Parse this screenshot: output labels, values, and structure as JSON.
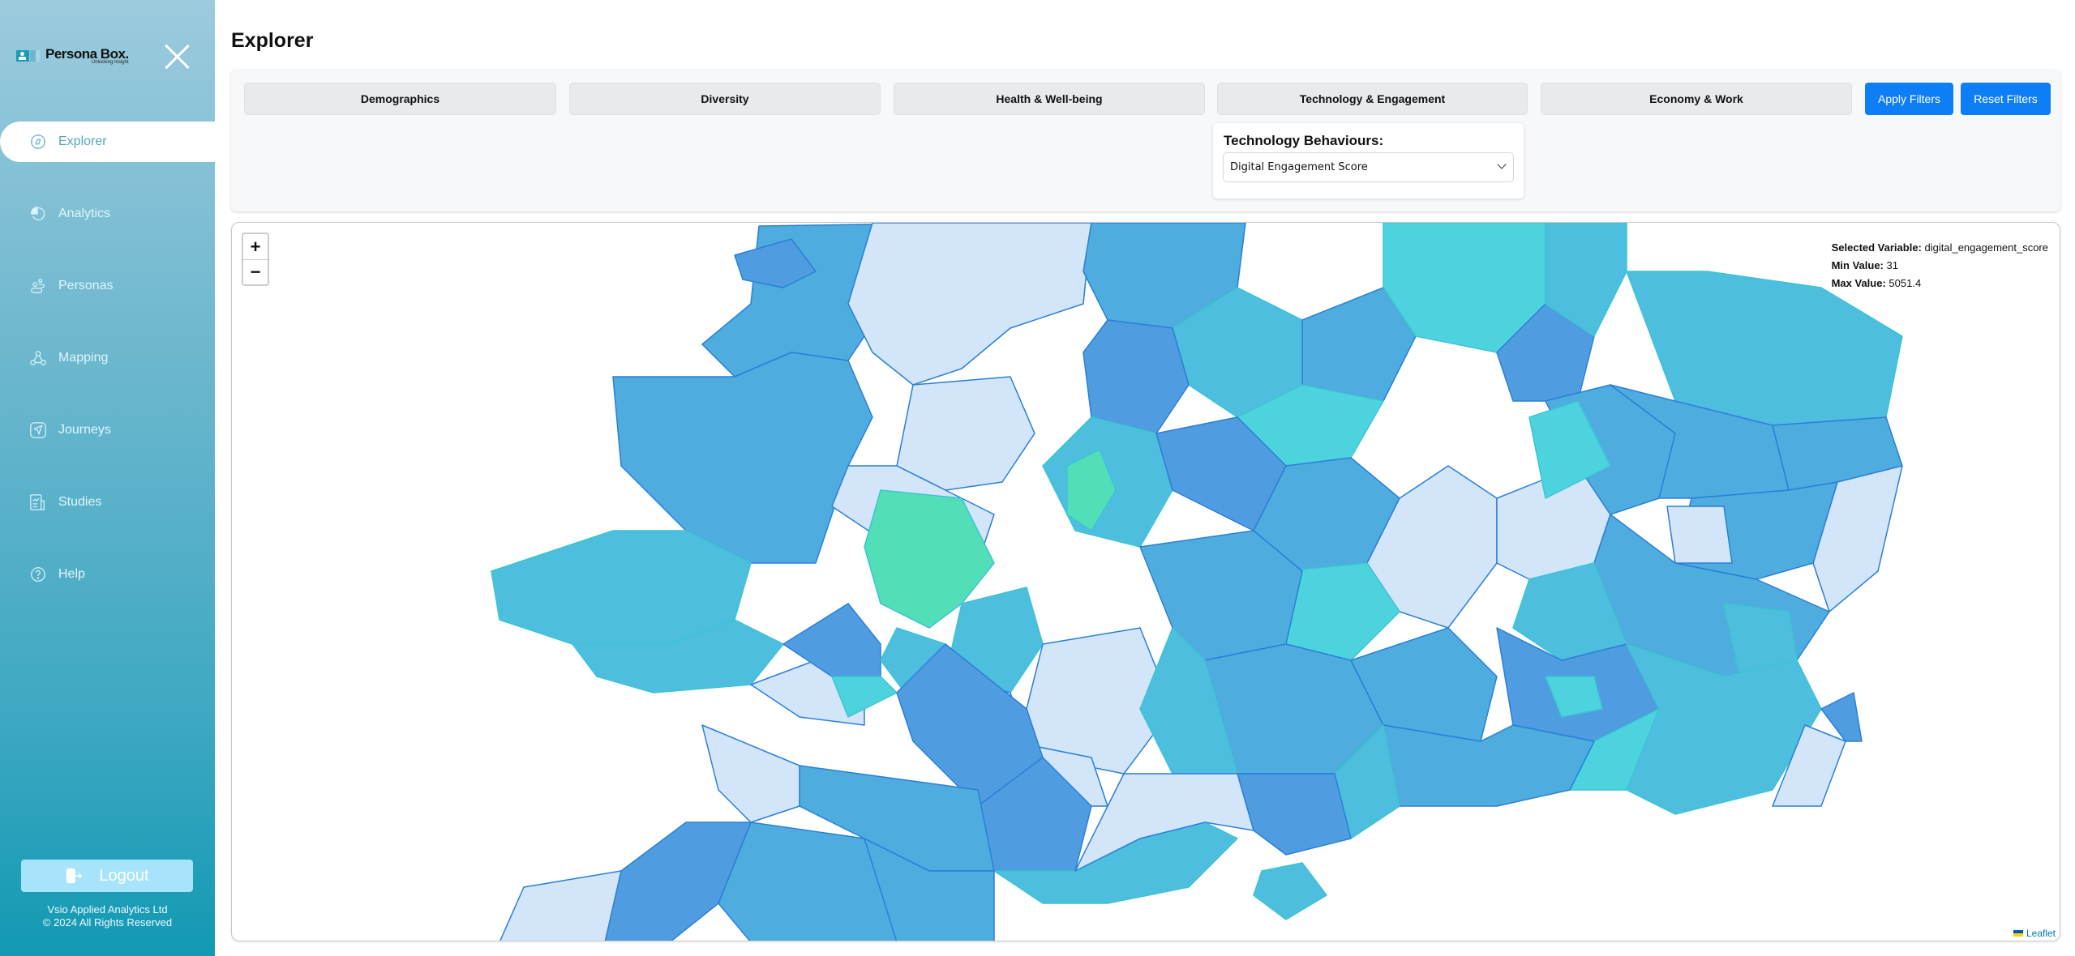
{
  "brand": {
    "name": "Persona Box.",
    "tagline": "Unlocking Insight"
  },
  "sidebar": {
    "items": [
      {
        "label": "Explorer",
        "icon": "compass-icon",
        "active": true
      },
      {
        "label": "Analytics",
        "icon": "pie-chart-icon",
        "active": false
      },
      {
        "label": "Personas",
        "icon": "people-icon",
        "active": false
      },
      {
        "label": "Mapping",
        "icon": "network-icon",
        "active": false
      },
      {
        "label": "Journeys",
        "icon": "navigation-icon",
        "active": false
      },
      {
        "label": "Studies",
        "icon": "document-chart-icon",
        "active": false
      },
      {
        "label": "Help",
        "icon": "help-circle-icon",
        "active": false
      }
    ],
    "logout_label": "Logout",
    "footer_company": "Vsio Applied Analytics Ltd",
    "footer_copyright": "© 2024 All Rights Reserved"
  },
  "page": {
    "title": "Explorer"
  },
  "filters": {
    "categories": [
      "Demographics",
      "Diversity",
      "Health & Well-being",
      "Technology & Engagement",
      "Economy & Work"
    ],
    "apply_label": "Apply Filters",
    "reset_label": "Reset Filters",
    "sub_filter": {
      "label": "Technology Behaviours:",
      "selected": "Digital Engagement Score"
    }
  },
  "map": {
    "zoom_in": "+",
    "zoom_out": "−",
    "info": {
      "selected_variable_label": "Selected Variable:",
      "selected_variable": "digital_engagement_score",
      "min_label": "Min Value:",
      "min_value": "31",
      "max_label": "Max Value:",
      "max_value": "5051.4"
    },
    "attribution": "Leaflet",
    "palette": {
      "none": "#d3e5f8",
      "low": "#4f9de0",
      "mid_low": "#4eadde",
      "mid": "#4dbedd",
      "mid_high": "#4cd3de",
      "high": "#52dfb8",
      "stroke_low": "#2a7fd8",
      "stroke_high": "#3cc4d4"
    }
  }
}
